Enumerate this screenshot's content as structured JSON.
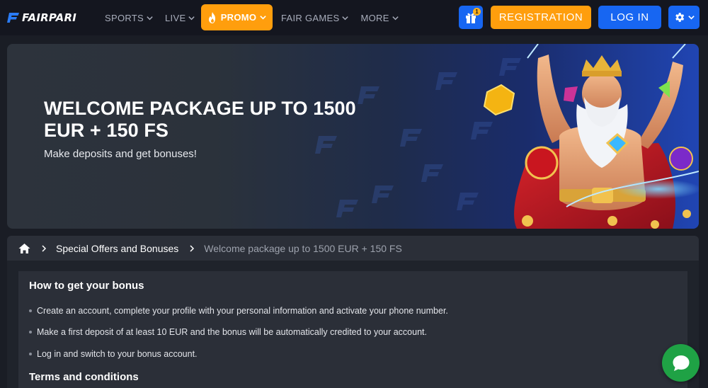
{
  "brand": {
    "name": "FAIRPARI"
  },
  "nav": {
    "items": [
      {
        "label": "SPORTS"
      },
      {
        "label": "LIVE"
      },
      {
        "label": "PROMO"
      },
      {
        "label": "FAIR GAMES"
      },
      {
        "label": "MORE"
      }
    ]
  },
  "header": {
    "gift_badge": "1",
    "registration_label": "REGISTRATION",
    "login_label": "LOG IN"
  },
  "banner": {
    "title": "WELCOME PACKAGE UP TO 1500 EUR + 150 FS",
    "subtitle": "Make deposits and get bonuses!"
  },
  "breadcrumb": {
    "link": "Special Offers and Bonuses",
    "current": "Welcome package up to 1500 EUR + 150 FS"
  },
  "content": {
    "how_title": "How to get your bonus",
    "steps": [
      "Create an account, complete your profile with your personal information and activate your phone number.",
      "Make a first deposit of at least 10 EUR and the bonus will be automatically credited to your account.",
      "Log in and switch to your bonus account."
    ],
    "terms_title": "Terms and conditions"
  },
  "colors": {
    "accent_orange": "#ff9e0d",
    "accent_blue": "#1766f2",
    "chat_green": "#1fa245",
    "background": "#1a1d25"
  },
  "icons": [
    "fairpari-logo-icon",
    "chevron-down-icon",
    "flame-icon",
    "gift-icon",
    "gear-icon",
    "home-icon",
    "chevron-right-icon",
    "chat-icon"
  ]
}
